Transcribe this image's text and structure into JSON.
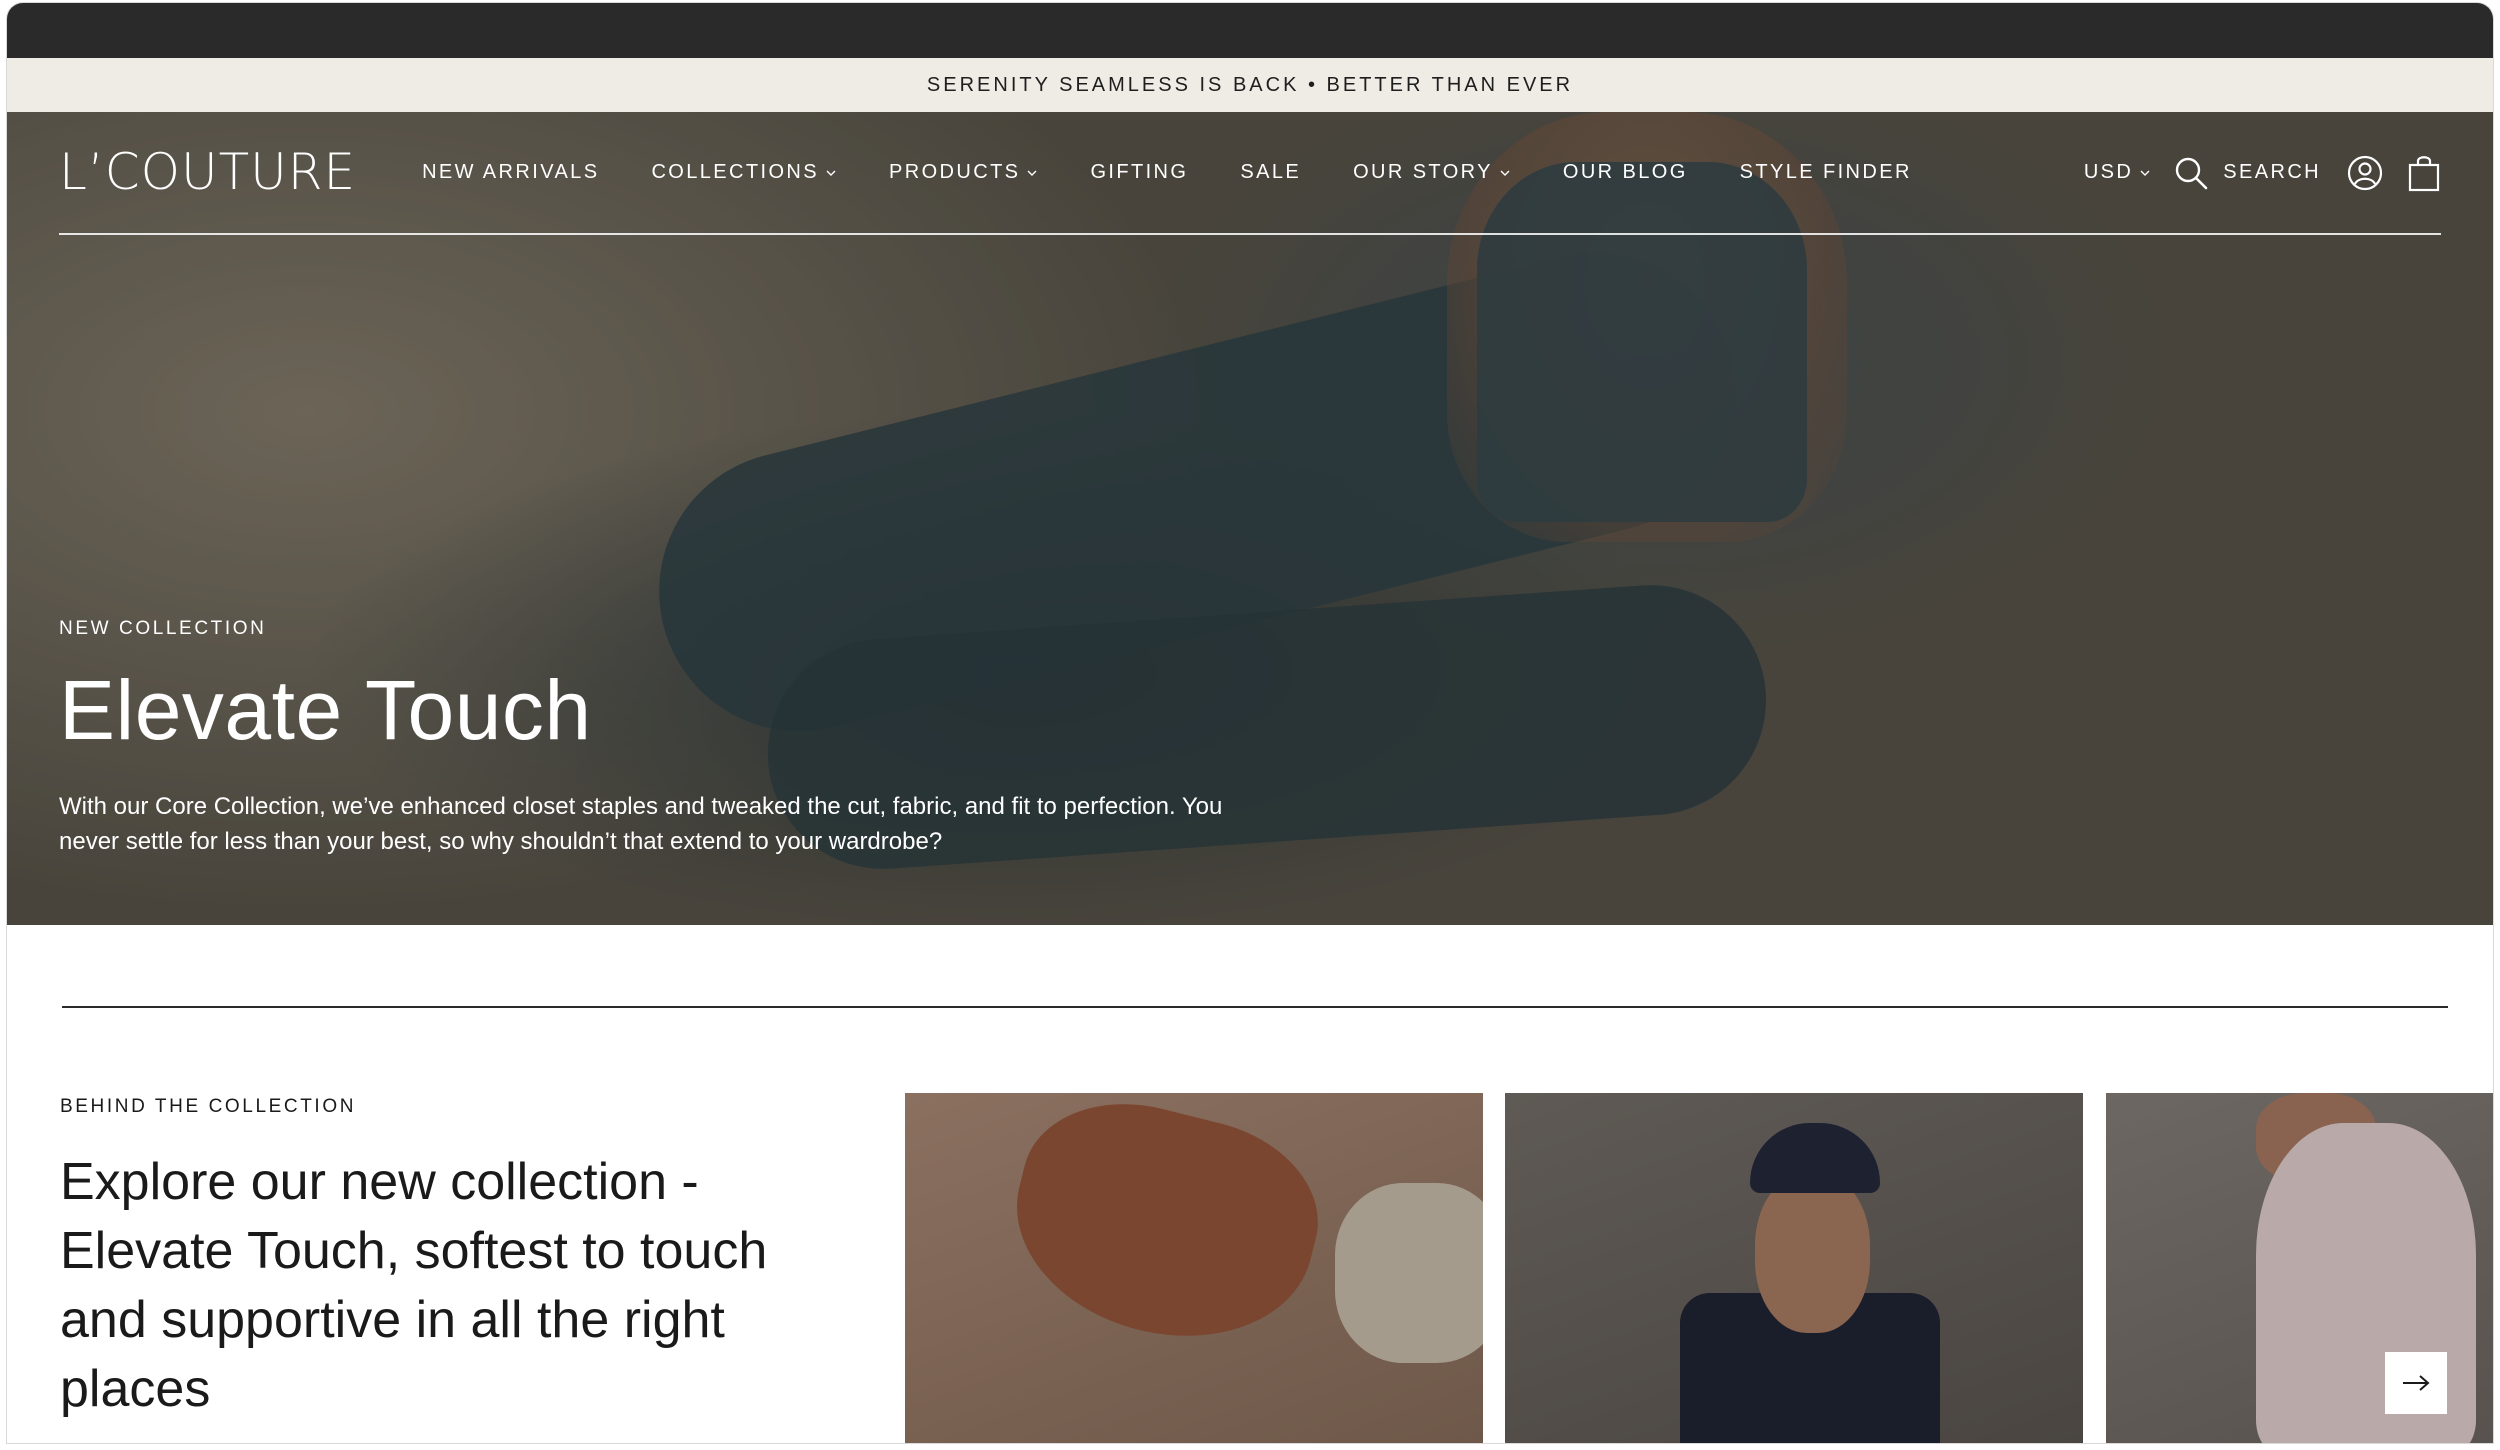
{
  "announcement": "SERENITY SEAMLESS IS BACK • BETTER THAN EVER",
  "brand": {
    "logo": "L’COUTURE"
  },
  "nav": {
    "items": [
      {
        "label": "NEW ARRIVALS",
        "dropdown": false
      },
      {
        "label": "COLLECTIONS",
        "dropdown": true
      },
      {
        "label": "PRODUCTS",
        "dropdown": true
      },
      {
        "label": "GIFTING",
        "dropdown": false
      },
      {
        "label": "SALE",
        "dropdown": false
      },
      {
        "label": "OUR STORY",
        "dropdown": true
      },
      {
        "label": "OUR BLOG",
        "dropdown": false
      },
      {
        "label": "STYLE FINDER",
        "dropdown": false
      }
    ],
    "currency": "USD",
    "search_label": "SEARCH",
    "icons": [
      "search-icon",
      "account-icon",
      "bag-icon"
    ]
  },
  "hero": {
    "eyebrow": "NEW COLLECTION",
    "title": "Elevate Touch",
    "description": "With our Core Collection, we’ve enhanced closet staples and tweaked the cut, fabric, and fit to perfection. You never settle for less than your best, so why shouldn’t that extend to your wardrobe?"
  },
  "behind": {
    "eyebrow": "BEHIND THE COLLECTION",
    "heading": "Explore our new collection - Elevate Touch, softest to touch and supportive in all the right places"
  },
  "carousel": {
    "cards": [
      "product-photo-bra",
      "model-photo-cap",
      "model-photo-back"
    ],
    "next_icon": "arrow-right-icon"
  },
  "colors": {
    "announcement_bg": "#efece6",
    "chrome_bar": "#2a2a2a",
    "text_dark": "#1a1a1a"
  }
}
